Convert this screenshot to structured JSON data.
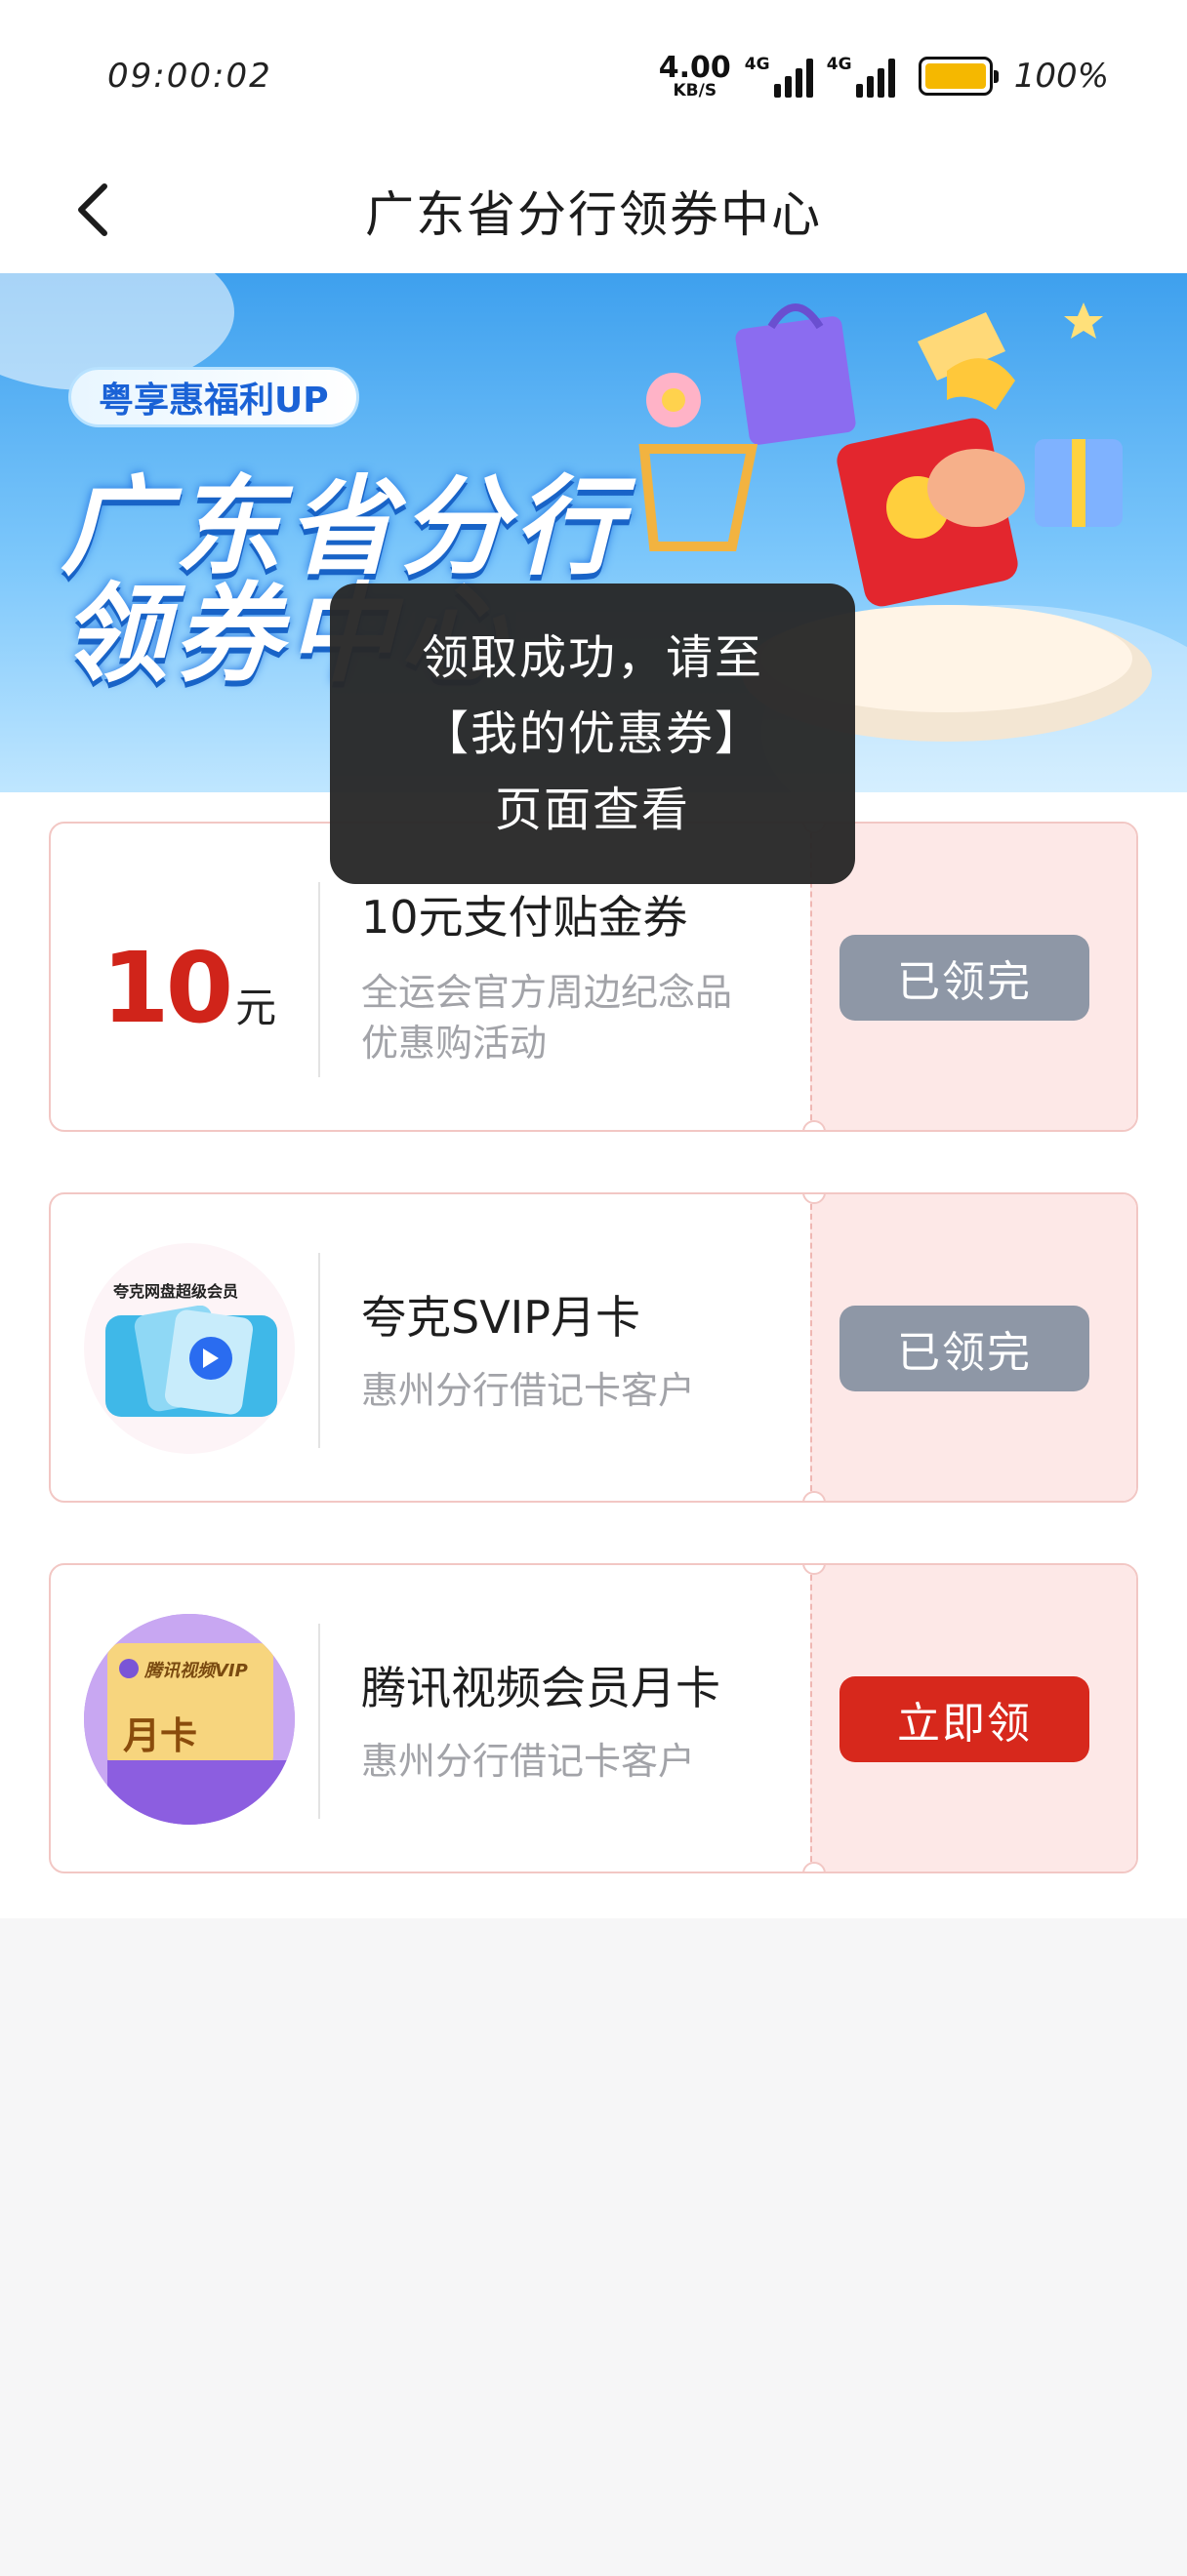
{
  "status": {
    "time": "09:00:02",
    "net_speed_value": "4.00",
    "net_speed_unit": "KB/S",
    "sim1_label": "4G",
    "sim2_label": "4G",
    "battery": "100%"
  },
  "nav": {
    "title": "广东省分行领券中心"
  },
  "banner": {
    "tag": "粤享惠福利UP",
    "title_line1": "广东省分行",
    "title_line2": "领券中心"
  },
  "toast": {
    "line1": "领取成功，请至",
    "line2": "【我的优惠券】",
    "line3": "页面查看"
  },
  "coupons": [
    {
      "amount": "10",
      "unit": "元",
      "title": "10元支付贴金券",
      "sub_line1": "全运会官方周边纪念品",
      "sub_line2": "优惠购活动",
      "button": "已领完"
    },
    {
      "thumb_caption": "夸克网盘超级会员",
      "title": "夸克SVIP月卡",
      "sub_line1": "惠州分行借记卡客户",
      "button": "已领完"
    },
    {
      "thumb_caption": "腾讯视频VIP",
      "thumb_badge": "月卡",
      "title": "腾讯视频会员月卡",
      "sub_line1": "惠州分行借记卡客户",
      "button": "立即领"
    }
  ],
  "colors": {
    "accent_red": "#d7281c",
    "disabled_gray": "#8e97a6",
    "card_pink": "#fde8e7"
  }
}
